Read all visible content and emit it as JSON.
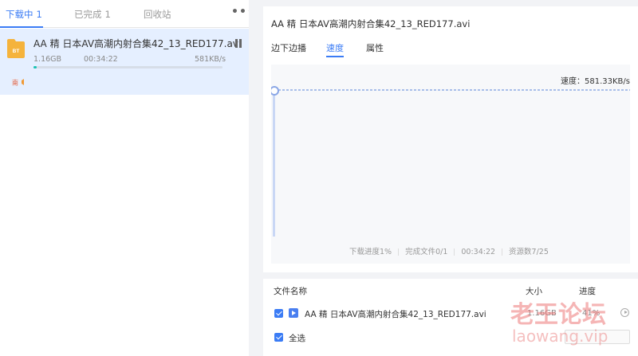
{
  "left": {
    "tabs": [
      {
        "label": "下载中",
        "count": "1"
      },
      {
        "label": "已完成",
        "count": "1"
      },
      {
        "label": "回收站"
      }
    ],
    "more_icon": "•••",
    "task": {
      "name": "AA 精 日本AV高潮内射合集42_13_RED177.avi",
      "icon_text": "BT",
      "size": "1.16GB",
      "time": "00:34:22",
      "speed": "581KB/s",
      "progress_pct": 1,
      "speaker_badge": "南"
    }
  },
  "detail": {
    "title": "AA 精 日本AV高潮内射合集42_13_RED177.avi",
    "tabs": [
      "边下边播",
      "速度",
      "属性"
    ],
    "active_tab": 1,
    "speed_label": "速度：581.33KB/s",
    "stats": [
      "下载进度1%",
      "完成文件0/1",
      "00:34:22",
      "资源数7/25"
    ]
  },
  "files": {
    "headers": {
      "name": "文件名称",
      "size": "大小",
      "progress": "进度"
    },
    "rows": [
      {
        "name": "AA 精 日本AV高潮内射合集42_13_RED177.avi",
        "size": "1.16GB",
        "progress": "41%"
      }
    ],
    "select_all": "全选"
  },
  "watermark": {
    "cn": "老王论坛",
    "en": "laowang.vip"
  },
  "colors": {
    "accent": "#3b7cf5",
    "selected_row": "#e5efff",
    "progress": "#19c4b5",
    "folder": "#f5b33c"
  }
}
